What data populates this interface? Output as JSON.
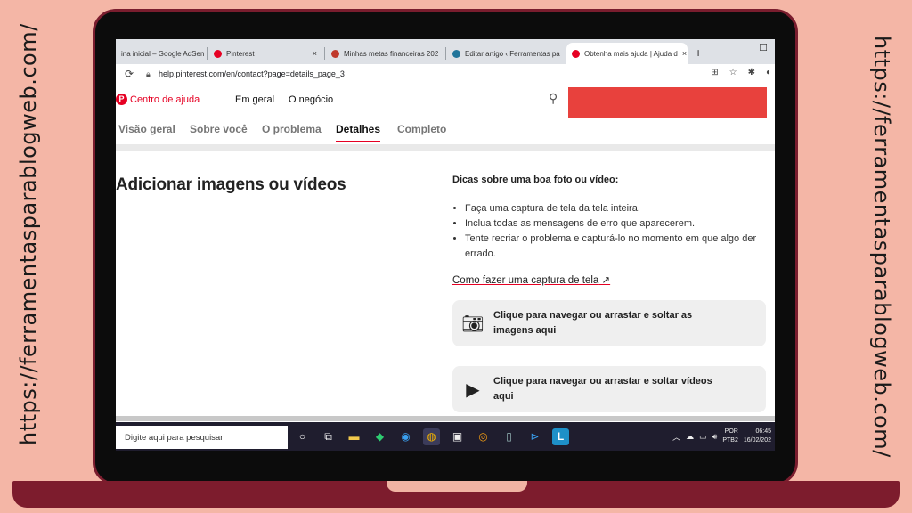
{
  "side_url": "https://ferramentasparablogweb.com/",
  "browser": {
    "tabs": [
      {
        "label": "ina inicial – Google AdSen",
        "color": "#4285f4",
        "active": false
      },
      {
        "label": "Pinterest",
        "color": "#e60023",
        "active": false
      },
      {
        "label": "Minhas metas financeiras 202",
        "color": "#c0392b",
        "active": false
      },
      {
        "label": "Editar artigo ‹ Ferramentas pa",
        "color": "#21759b",
        "active": false
      },
      {
        "label": "Obtenha mais ajuda | Ajuda d",
        "color": "#e60023",
        "active": true
      }
    ],
    "close_glyph": "×",
    "new_tab": "+",
    "url": "help.pinterest.com/en/contact?page=details_page_3"
  },
  "site": {
    "logo_letter": "P",
    "brand": "Centro de ajuda",
    "nav": [
      "Em geral",
      "O negócio"
    ]
  },
  "steps": [
    "Visão geral",
    "Sobre você",
    "O problema",
    "Detalhes",
    "Completo"
  ],
  "main": {
    "heading": "Adicionar imagens ou vídeos",
    "tips_title": "Dicas sobre uma boa foto ou vídeo:",
    "tips": [
      "Faça uma captura de tela da tela inteira.",
      "Inclua todas as mensagens de erro que aparecerem.",
      "Tente recriar o problema e capturá-lo no momento em que algo der errado."
    ],
    "howto_link": "Como fazer uma captura de tela",
    "upload_images": "Clique para navegar ou arrastar e soltar as imagens aqui",
    "upload_videos": "Clique para navegar ou arrastar e soltar vídeos aqui"
  },
  "taskbar": {
    "search_placeholder": "Digite aqui para pesquisar",
    "lang1": "POR",
    "lang2": "PTB2",
    "time": "06:45",
    "date": "16/02/202"
  }
}
